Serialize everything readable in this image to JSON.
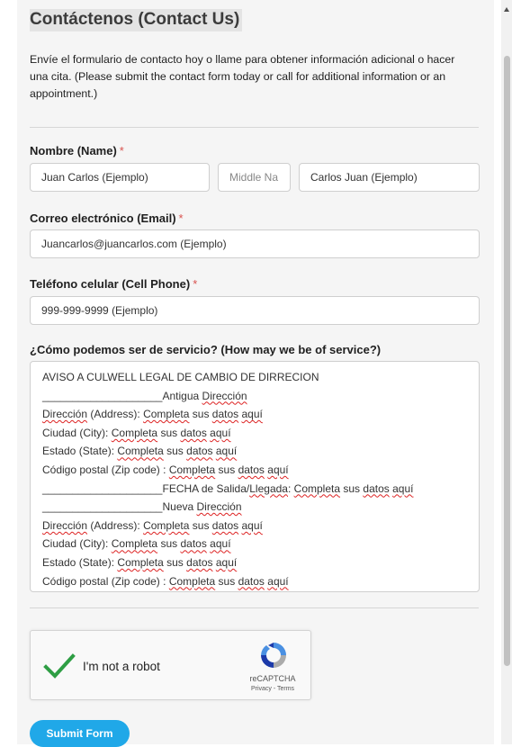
{
  "form": {
    "title": "Contáctenos (Contact Us)",
    "intro": "Envíe el formulario de contacto hoy o llame para obtener información adicional o hacer una cita.  (Please submit the contact form today or call for additional information or an appointment.)",
    "name": {
      "label": "Nombre (Name)",
      "required": "*",
      "first_value": "Juan Carlos (Ejemplo)",
      "middle_placeholder": "Middle Na",
      "last_value": "Carlos Juan (Ejemplo)"
    },
    "email": {
      "label": "Correo electrónico (Email)",
      "required": "*",
      "value": "Juancarlos@juancarlos.com (Ejemplo)"
    },
    "phone": {
      "label": "Teléfono celular (Cell Phone)",
      "required": "*",
      "value": "999-999-9999 (Ejemplo)"
    },
    "service": {
      "label": "¿Cómo podemos ser de servicio? (How may we be of service?)",
      "lines": [
        "AVISO A CULWELL LEGAL DE CAMBIO DE DIRRECION",
        "____________________Antigua Dirección",
        "Dirección (Address): Completa sus datos aquí",
        "Ciudad (City): Completa sus datos aquí",
        "Estado (State): Completa sus datos aquí",
        "Código postal (Zip code) : Completa sus datos aquí",
        "____________________FECHA de Salida/Llegada: Completa sus datos aquí",
        "____________________Nueva Dirección",
        "Dirección (Address): Completa sus datos aquí",
        "Ciudad (City): Completa sus datos aquí",
        "Estado (State): Completa sus datos aquí",
        "Código postal (Zip code) : Completa sus datos aquí"
      ]
    },
    "captcha": {
      "label": "I'm not a robot",
      "brand": "reCAPTCHA",
      "links": "Privacy - Terms",
      "checked": true
    },
    "submit_label": "Submit Form"
  },
  "colors": {
    "accent": "#20a8e8",
    "required": "#d9534f",
    "check": "#2e9e44"
  }
}
